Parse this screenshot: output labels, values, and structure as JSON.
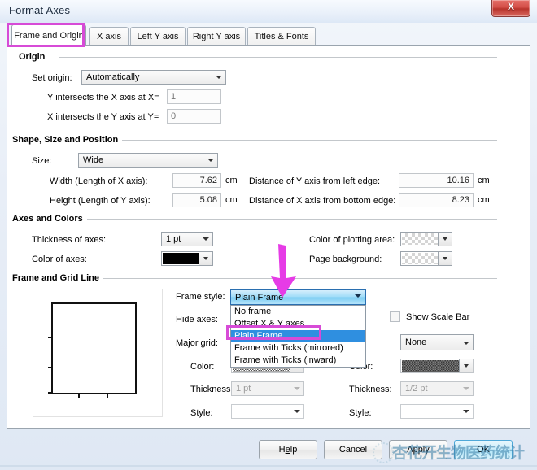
{
  "window": {
    "title": "Format Axes",
    "close_label": "X"
  },
  "tabs": [
    {
      "label": "Frame and Origin",
      "active": true
    },
    {
      "label": "X axis",
      "active": false
    },
    {
      "label": "Left Y axis",
      "active": false
    },
    {
      "label": "Right Y axis",
      "active": false
    },
    {
      "label": "Titles & Fonts",
      "active": false
    }
  ],
  "origin": {
    "group_title": "Origin",
    "set_origin_label": "Set origin:",
    "set_origin_value": "Automatically",
    "y_intersect_label": "Y intersects the X axis at X=",
    "y_intersect_value": "1",
    "x_intersect_label": "X intersects the Y axis at Y=",
    "x_intersect_value": "0"
  },
  "shape": {
    "group_title": "Shape, Size and Position",
    "size_label": "Size:",
    "size_value": "Wide",
    "width_label": "Width (Length of X axis):",
    "width_value": "7.62",
    "width_unit": "cm",
    "height_label": "Height (Length of Y axis):",
    "height_value": "5.08",
    "height_unit": "cm",
    "dist_y_label": "Distance of Y axis from left edge:",
    "dist_y_value": "10.16",
    "dist_y_unit": "cm",
    "dist_x_label": "Distance of X axis from bottom edge:",
    "dist_x_value": "8.23",
    "dist_x_unit": "cm"
  },
  "axes_colors": {
    "group_title": "Axes and Colors",
    "thickness_label": "Thickness of axes:",
    "thickness_value": "1 pt",
    "color_axes_label": "Color of axes:",
    "color_axes_value": "#000000",
    "plot_area_label": "Color of plotting area:",
    "plot_area_value": "transparent",
    "page_bg_label": "Page background:",
    "page_bg_value": "transparent"
  },
  "frame_grid": {
    "group_title": "Frame and Grid Line",
    "frame_style_label": "Frame style:",
    "frame_style_value": "Plain Frame",
    "frame_style_options": [
      "No frame",
      "Offset X & Y axes",
      "Plain Frame",
      "Frame with Ticks (mirrored)",
      "Frame with Ticks (inward)"
    ],
    "frame_style_selected": "Plain Frame",
    "hide_axes_label": "Hide axes:",
    "major_grid_label": "Major grid:",
    "show_scale_bar_label": "Show Scale Bar",
    "show_scale_bar_checked": false,
    "left_color_label": "Color:",
    "left_thickness_label": "Thickness:",
    "left_thickness_value": "1 pt",
    "left_style_label": "Style:",
    "left_style_value": "",
    "right_grid_value": "None",
    "right_color_label": "Color:",
    "right_thickness_label": "Thickness:",
    "right_thickness_value": "1/2 pt",
    "right_style_label": "Style:",
    "right_style_value": ""
  },
  "footer": {
    "help_pre": "H",
    "help_key": "e",
    "help_post": "lp",
    "help_label": "Help",
    "cancel_label": "Cancel",
    "apply_label": "Apply",
    "ok_label": "OK"
  },
  "annotations": {
    "tab_highlight_color": "#d74bd7",
    "option_highlight_color": "#d74bd7",
    "arrow_color": "#e63ce6"
  },
  "watermark": {
    "text": "杏花开生物医药统计"
  }
}
